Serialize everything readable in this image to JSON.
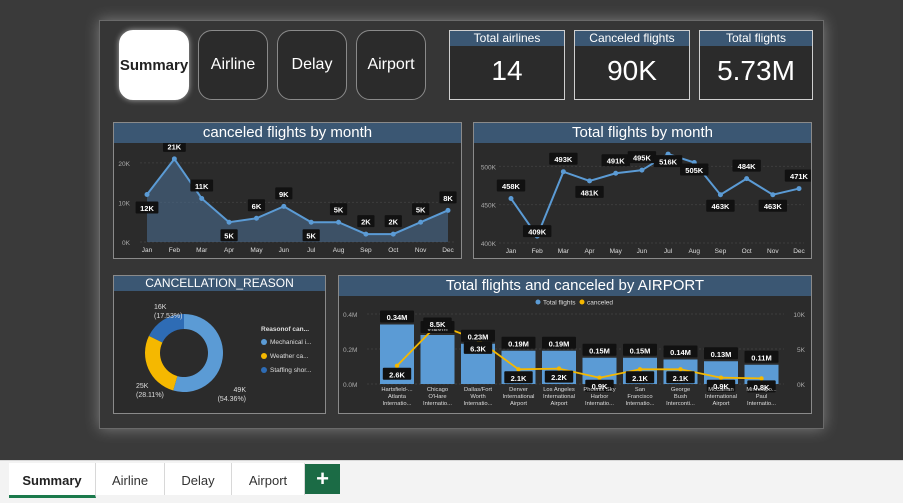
{
  "nav": {
    "summary": "Summary",
    "airline": "Airline",
    "delay": "Delay",
    "airport": "Airport"
  },
  "kpis": {
    "total_airlines": {
      "title": "Total airlines",
      "value": "14"
    },
    "canceled_flights": {
      "title": "Canceled flights",
      "value": "90K"
    },
    "total_flights": {
      "title": "Total flights",
      "value": "5.73M"
    }
  },
  "panels": {
    "canceled_by_month": "canceled flights by month",
    "total_by_month": "Total flights by month",
    "cancellation_reason": "CANCELLATION_REASON",
    "airport": "Total flights and canceled by AIRPORT"
  },
  "tabs": [
    "Summary",
    "Airline",
    "Delay",
    "Airport"
  ],
  "add_tab": "+",
  "colors": {
    "accent_blue": "#5b9bd5",
    "header_blue": "#3b5773",
    "orange": "#f5b800",
    "dark_blue": "#2e6cb5",
    "tab_green": "#1b6b45"
  },
  "chart_data": [
    {
      "type": "area",
      "title": "canceled flights by month",
      "categories": [
        "Jan",
        "Feb",
        "Mar",
        "Apr",
        "May",
        "Jun",
        "Jul",
        "Aug",
        "Sep",
        "Oct",
        "Nov",
        "Dec"
      ],
      "values": [
        12000,
        21000,
        11000,
        5000,
        6000,
        9000,
        5000,
        5000,
        2000,
        2000,
        5000,
        8000
      ],
      "labels": [
        "12K",
        "21K",
        "11K",
        "5K",
        "6K",
        "9K",
        "5K",
        "5K",
        "2K",
        "2K",
        "5K",
        "8K"
      ],
      "yticks": [
        "0K",
        "10K",
        "20K"
      ],
      "ylim": [
        0,
        23000
      ],
      "grid": true
    },
    {
      "type": "line",
      "title": "Total flights by month",
      "categories": [
        "Jan",
        "Feb",
        "Mar",
        "Apr",
        "May",
        "Jun",
        "Jul",
        "Aug",
        "Sep",
        "Oct",
        "Nov",
        "Dec"
      ],
      "values": [
        458000,
        409000,
        493000,
        481000,
        491000,
        495000,
        516000,
        505000,
        463000,
        484000,
        463000,
        471000
      ],
      "labels": [
        "458K",
        "409K",
        "493K",
        "481K",
        "491K",
        "495K",
        "516K",
        "505K",
        "463K",
        "484K",
        "463K",
        "471K"
      ],
      "yticks": [
        "400K",
        "450K",
        "500K"
      ],
      "ylim": [
        400000,
        520000
      ],
      "grid": true
    },
    {
      "type": "pie",
      "title": "CANCELLATION_REASON",
      "legend_title": "Reasonof can...",
      "legend_position": "right",
      "series": [
        {
          "name": "Mechanical i...",
          "value": 49000,
          "label": "49K\n(54.36%)",
          "color": "#5b9bd5"
        },
        {
          "name": "Weather ca...",
          "value": 25000,
          "label": "25K\n(28.11%)",
          "color": "#f5b800"
        },
        {
          "name": "Staffing shor...",
          "value": 16000,
          "label": "16K\n(17.53%)",
          "color": "#2e6cb5"
        }
      ]
    },
    {
      "type": "bar",
      "title": "Total flights and canceled by AIRPORT",
      "legend": [
        "Total flights",
        "canceled"
      ],
      "legend_position": "top-center",
      "categories": [
        "Hartsfield-... Atlanta Internatio...",
        "Chicago O'Hare Internatio...",
        "Dallas/Fort Worth Internatio...",
        "Denver International Airport",
        "Los Angeles International Airport",
        "Phoenix Sky Harbor Internatio...",
        "San Francisco Internatio...",
        "George Bush Interconti...",
        "McCarran International Airport",
        "Minneapo... Paul Internatio..."
      ],
      "category_lines": [
        [
          "Hartsfield-...",
          "Atlanta",
          "Internatio..."
        ],
        [
          "Chicago",
          "O'Hare",
          "Internatio..."
        ],
        [
          "Dallas/Fort",
          "Worth",
          "Internatio..."
        ],
        [
          "Denver",
          "International",
          "Airport"
        ],
        [
          "Los Angeles",
          "International",
          "Airport"
        ],
        [
          "Phoenix Sky",
          "Harbor",
          "Internatio..."
        ],
        [
          "San",
          "Francisco",
          "Internatio..."
        ],
        [
          "George",
          "Bush",
          "Interconti..."
        ],
        [
          "McCarran",
          "International",
          "Airport"
        ],
        [
          "Minneapo...",
          "Paul",
          "Internatio..."
        ]
      ],
      "series": [
        {
          "name": "Total flights",
          "values": [
            340000,
            280000,
            230000,
            190000,
            190000,
            150000,
            150000,
            140000,
            130000,
            110000
          ],
          "labels": [
            "0.34M",
            "0.28M",
            "0.23M",
            "0.19M",
            "0.19M",
            "0.15M",
            "0.15M",
            "0.14M",
            "0.13M",
            "0.11M"
          ]
        },
        {
          "name": "canceled",
          "values": [
            2600,
            8500,
            6300,
            2100,
            2200,
            900,
            2100,
            2100,
            900,
            800
          ],
          "labels": [
            "2.6K",
            "8.5K",
            "6.3K",
            "2.1K",
            "2.2K",
            "0.9K",
            "2.1K",
            "2.1K",
            "0.9K",
            "0.8K"
          ]
        }
      ],
      "yticks_left": [
        "0.0M",
        "0.2M",
        "0.4M"
      ],
      "yticks_right": [
        "0K",
        "5K",
        "10K"
      ],
      "ylim_left": [
        0,
        400000
      ],
      "ylim_right": [
        0,
        10000
      ]
    }
  ]
}
